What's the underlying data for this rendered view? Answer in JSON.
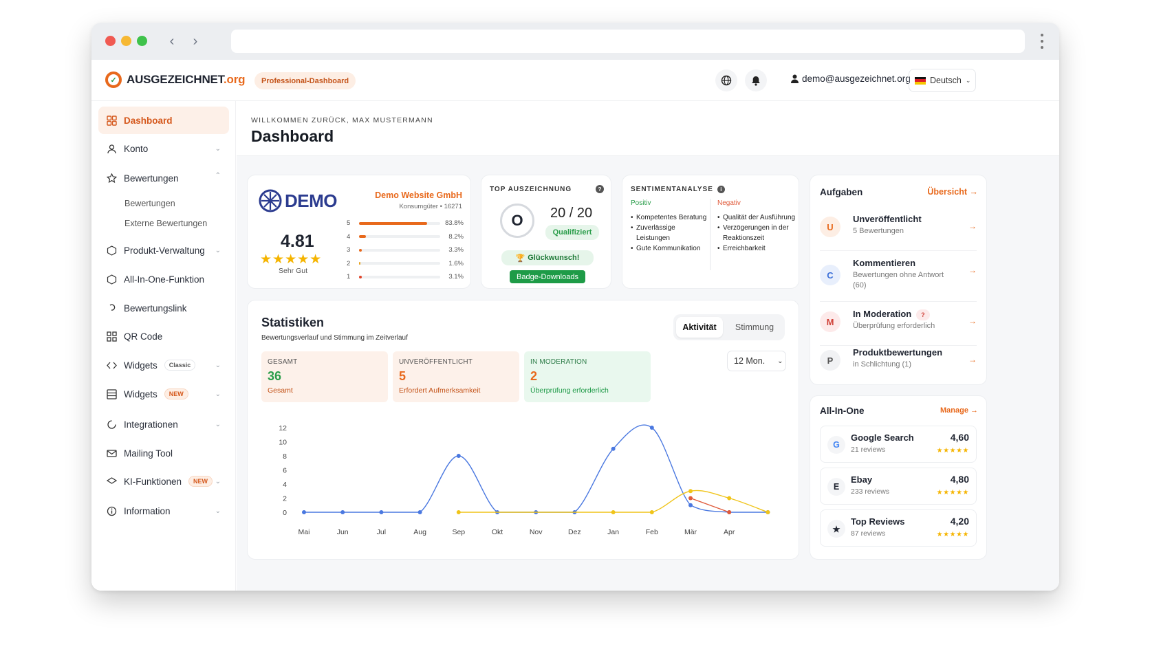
{
  "brand": {
    "name_main": "AUSGEZEICHNET",
    "name_suffix": ".org",
    "plan_badge": "Professional-Dashboard"
  },
  "header": {
    "user_email": "demo@ausgezeichnet.org",
    "language": "Deutsch"
  },
  "sidebar": {
    "items": [
      {
        "label": "Dashboard"
      },
      {
        "label": "Konto"
      },
      {
        "label": "Bewertungen"
      },
      {
        "label": "Produkt-Verwaltung"
      },
      {
        "label": "All-In-One-Funktion"
      },
      {
        "label": "Bewertungslink"
      },
      {
        "label": "QR Code"
      },
      {
        "label": "Widgets",
        "badge": "Classic"
      },
      {
        "label": "Widgets",
        "badge": "NEW"
      },
      {
        "label": "Integrationen"
      },
      {
        "label": "Mailing Tool"
      },
      {
        "label": "KI-Funktionen",
        "badge": "NEW"
      },
      {
        "label": "Information"
      }
    ],
    "sub_items": [
      {
        "label": "Bewertungen"
      },
      {
        "label": "Externe Bewertungen"
      }
    ]
  },
  "page": {
    "welcome": "WILLKOMMEN ZURÜCK, MAX MUSTERMANN",
    "title": "Dashboard"
  },
  "rating_card": {
    "logo_text": "DEMO",
    "company": "Demo Website GmbH",
    "category": "Konsumgüter • 16271",
    "score": "4.81",
    "stars": "★★★★★",
    "verdict": "Sehr Gut",
    "distribution": [
      {
        "stars": "5",
        "percent": "83.8%",
        "value": 83.8
      },
      {
        "stars": "4",
        "percent": "8.2%",
        "value": 8.2
      },
      {
        "stars": "3",
        "percent": "3.3%",
        "value": 3.3
      },
      {
        "stars": "2",
        "percent": "1.6%",
        "value": 1.6
      },
      {
        "stars": "1",
        "percent": "3.1%",
        "value": 3.1
      }
    ]
  },
  "award_card": {
    "title": "TOP AUSZEICHNUNG",
    "gauge_letter": "O",
    "score": "20 / 20",
    "status": "Qualifiziert",
    "congrats": "Glückwunsch!",
    "download": "Badge-Downloads"
  },
  "sentiment_card": {
    "title": "SENTIMENTANALYSE",
    "positive_label": "Positiv",
    "positive": [
      "Kompetentes Beratung",
      "Zuverlässige Leistungen",
      "Gute Kommunikation"
    ],
    "negative_label": "Negativ",
    "negative": [
      "Qualität der Ausführung",
      "Verzögerungen in der Reaktionszeit",
      "Erreichbarkeit"
    ]
  },
  "stats": {
    "title": "Statistiken",
    "subtitle": "Bewertungsverlauf und Stimmung im Zeitverlauf",
    "tabs": [
      "Aktivität",
      "Stimmung"
    ],
    "period": "12 Mon.",
    "metrics": [
      {
        "label": "GESAMT",
        "value": "36",
        "sub": "Gesamt"
      },
      {
        "label": "UNVERÖFFENTLICHT",
        "value": "5",
        "sub": "Erfordert Aufmerksamkeit"
      },
      {
        "label": "IN MODERATION",
        "value": "2",
        "sub": "Überprüfung erforderlich"
      }
    ]
  },
  "chart_data": {
    "type": "line",
    "categories": [
      "Mai",
      "Jun",
      "Jul",
      "Aug",
      "Sep",
      "Okt",
      "Nov",
      "Dez",
      "Jan",
      "Feb",
      "Mär",
      "Apr"
    ],
    "ylim": [
      0,
      12
    ],
    "yticks": [
      "0",
      "2",
      "4",
      "6",
      "8",
      "10",
      "12"
    ],
    "grid": false,
    "series": [
      {
        "color": "#4a78e0",
        "values": [
          0,
          0,
          0,
          0,
          8,
          0,
          0,
          0,
          9,
          12,
          1,
          0
        ],
        "end": 0
      },
      {
        "color": "#f0c419",
        "values": [
          null,
          null,
          null,
          null,
          0,
          null,
          null,
          null,
          0,
          0,
          3,
          2
        ],
        "end": 0
      },
      {
        "color": "#e05a3a",
        "values": [
          null,
          null,
          null,
          null,
          null,
          null,
          null,
          null,
          null,
          null,
          2,
          0
        ],
        "end": null
      }
    ]
  },
  "tasks": {
    "title": "Aufgaben",
    "link": "Übersicht →",
    "items": [
      {
        "avatar": "U",
        "title": "Unveröffentlicht",
        "desc": "5 Bewertungen"
      },
      {
        "avatar": "C",
        "title": "Kommentieren",
        "desc": "Bewertungen ohne Antwort (60)"
      },
      {
        "avatar": "M",
        "title": "In Moderation",
        "badge": "?",
        "desc": "Überprüfung erforderlich"
      },
      {
        "avatar": "P",
        "title": "Produktbewertungen",
        "desc": "in Schlichtung (1)"
      }
    ]
  },
  "all_in_one": {
    "title": "All-In-One",
    "link": "Manage →",
    "items": [
      {
        "icon": "G",
        "name": "Google Search",
        "reviews": "21 reviews",
        "score": "4,60",
        "stars": "★★★★★"
      },
      {
        "icon": "E",
        "name": "Ebay",
        "reviews": "233 reviews",
        "score": "4,80",
        "stars": "★★★★★"
      },
      {
        "icon": "★",
        "name": "Top Reviews",
        "reviews": "87 reviews",
        "score": "4,20",
        "stars": "★★★★★"
      }
    ]
  },
  "colors": {
    "accent": "#e8691c",
    "green": "#2a9d4a",
    "blue": "#4a78e0",
    "yellow": "#f0c419",
    "red": "#e05a3a"
  }
}
